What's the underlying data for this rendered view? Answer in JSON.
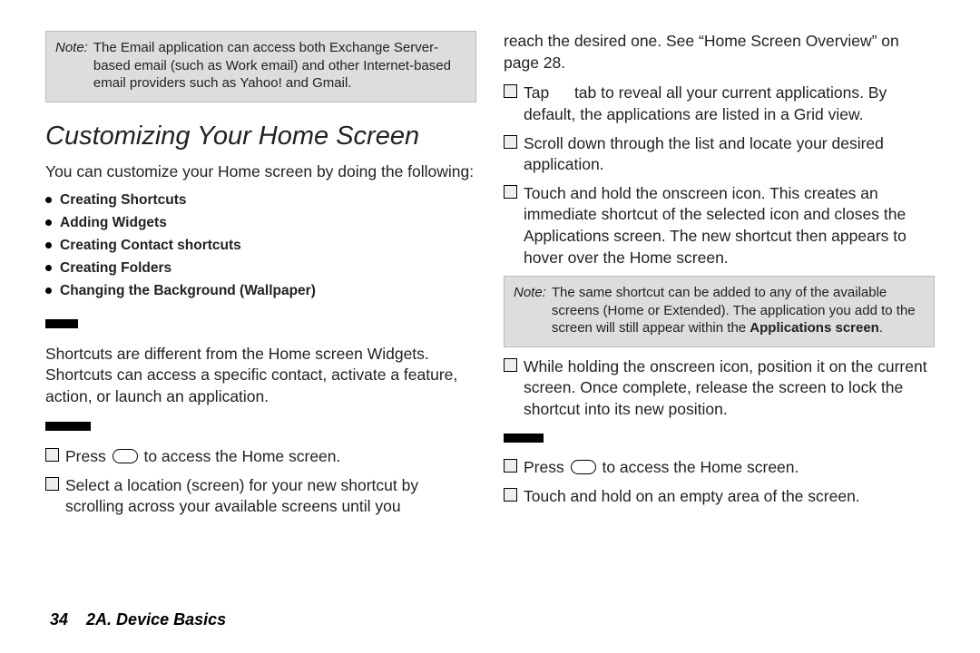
{
  "leftNote": {
    "label": "Note:",
    "text": "The Email application can access both Exchange Server-based email (such as Work email) and other Internet-based email providers such as Yahoo! and Gmail."
  },
  "sectionTitle": "Customizing Your Home Screen",
  "intro": "You can customize your Home screen by doing the following:",
  "features": [
    "Creating Shortcuts",
    "Adding Widgets",
    "Creating Contact shortcuts",
    "Creating Folders",
    "Changing the Background (Wallpaper)"
  ],
  "shortcutsPara": "Shortcuts are different from the Home screen Widgets. Shortcuts can access a specific contact, activate a feature, action, or launch an application.",
  "l_step1a": "Press ",
  "l_step1b": " to access the Home screen.",
  "l_step2": "Select a location (screen) for your new shortcut by scrolling across your available screens until you",
  "r_cont": "reach the desired one. See “Home Screen Overview” on page 28.",
  "r_step3a": "Tap ",
  "r_step3b": " tab to reveal all your current applications. By default, the applications are listed in a Grid view.",
  "r_step4": "Scroll down through the list and locate your desired application.",
  "r_step5": "Touch and hold the onscreen icon. This creates an immediate shortcut of the selected icon and closes the Applications screen. The new shortcut then appears to hover over the Home screen.",
  "rightNote": {
    "label": "Note:",
    "textA": "The same shortcut can be added to any of the available screens (Home or Extended). The application you add to the screen will still appear within the ",
    "bold": "Applications screen",
    "textB": "."
  },
  "r_step6": "While holding the onscreen icon, position it on the current screen. Once complete, release the screen to lock the shortcut into its new position.",
  "r_b1a": "Press ",
  "r_b1b": " to access the Home screen.",
  "r_b2": "Touch and hold on an empty area of the screen.",
  "footer": {
    "page": "34",
    "chapter": "2A. Device Basics"
  }
}
